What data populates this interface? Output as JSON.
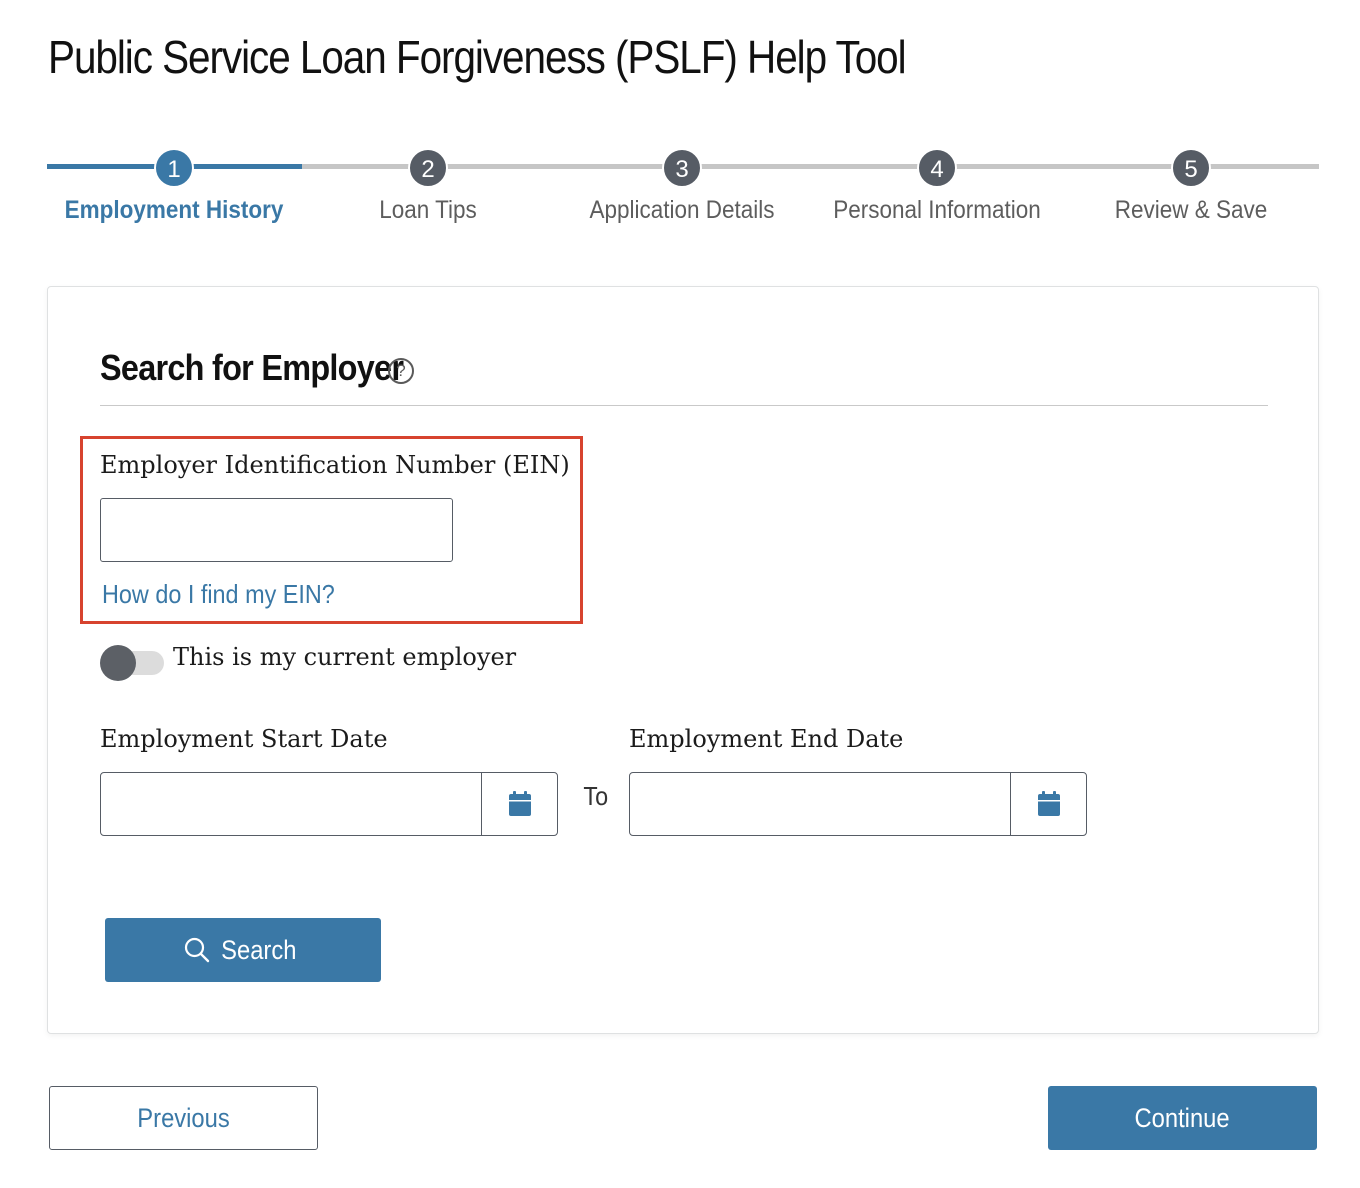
{
  "page": {
    "title": "Public Service Loan Forgiveness (PSLF) Help Tool"
  },
  "stepper": {
    "current_step": 1,
    "steps": [
      {
        "number": "1",
        "label": "Employment History"
      },
      {
        "number": "2",
        "label": "Loan Tips"
      },
      {
        "number": "3",
        "label": "Application Details"
      },
      {
        "number": "4",
        "label": "Personal Information"
      },
      {
        "number": "5",
        "label": "Review & Save"
      }
    ]
  },
  "search_section": {
    "title": "Search for Employer",
    "help_icon": "?",
    "ein": {
      "label": "Employer Identification Number (EIN)",
      "value": "",
      "placeholder": "",
      "help_link": "How do I find my EIN?"
    },
    "current_employer_toggle": {
      "label": "This is my current employer",
      "checked": false
    },
    "start_date": {
      "label": "Employment Start Date",
      "value": ""
    },
    "to_text": "To",
    "end_date": {
      "label": "Employment End Date",
      "value": ""
    },
    "search_button": "Search"
  },
  "nav": {
    "previous": "Previous",
    "continue": "Continue"
  },
  "colors": {
    "primary": "#3a78a6",
    "highlight": "#d7432e",
    "inactive_step": "#565c65"
  },
  "icons": {
    "calendar": "calendar-icon",
    "search": "search-icon",
    "help": "question-circle-icon"
  }
}
